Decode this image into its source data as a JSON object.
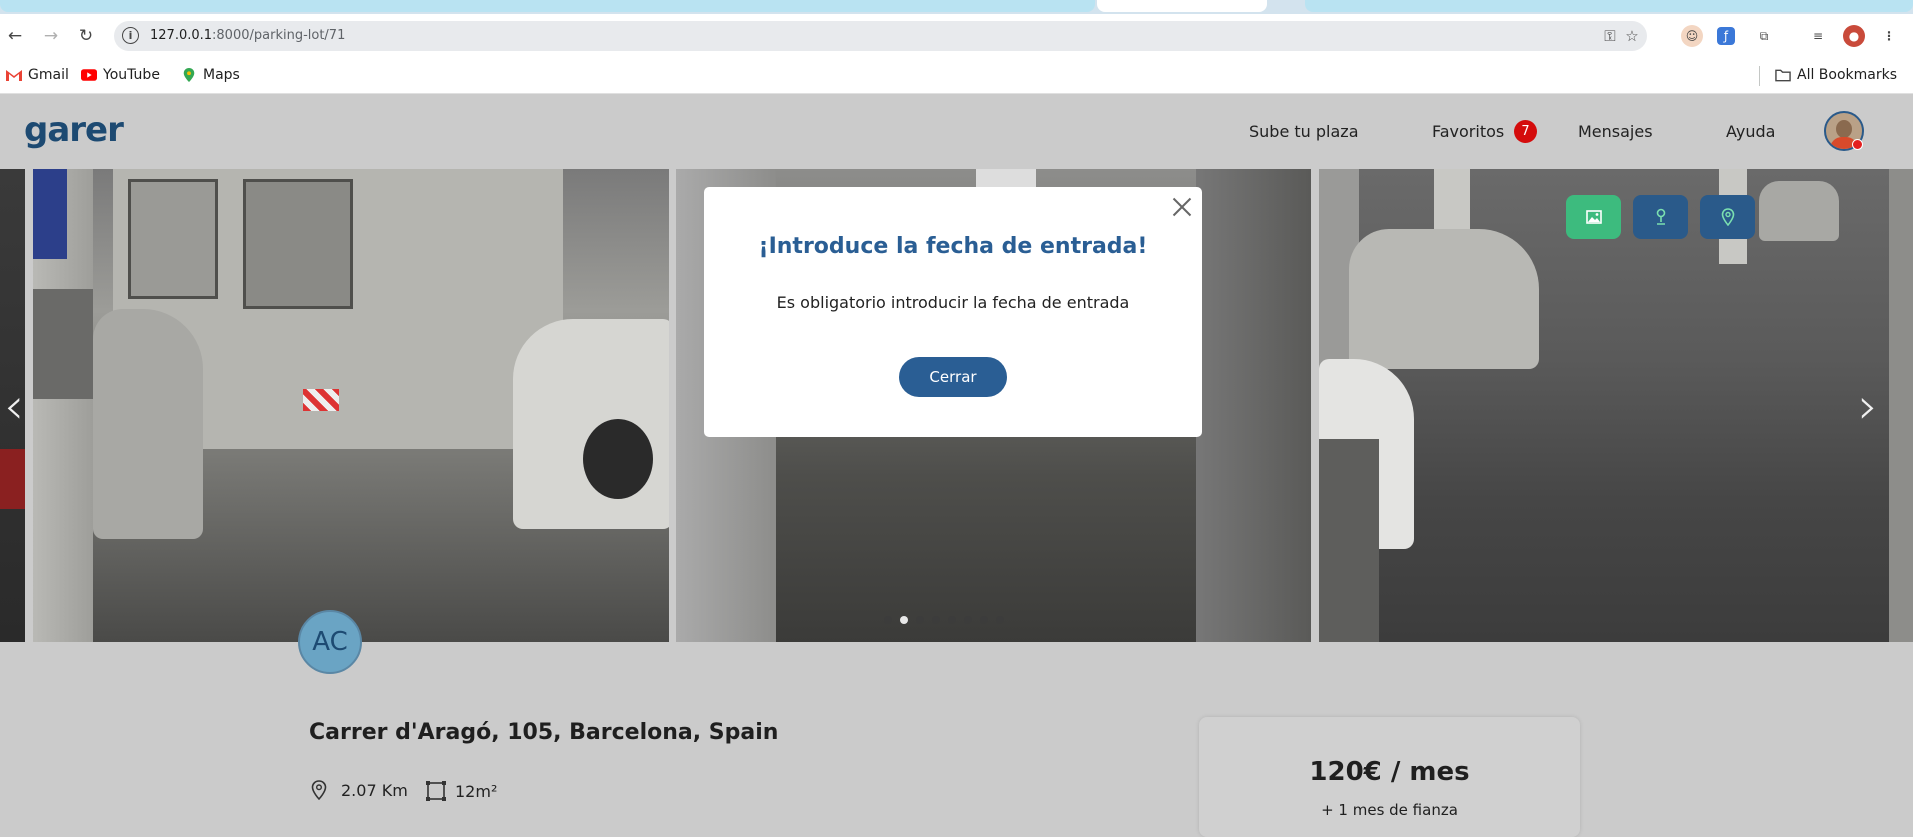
{
  "browser": {
    "url_host": "127.0.0.1",
    "url_rest": ":8000/parking-lot/71",
    "bookmarks": [
      "Gmail",
      "YouTube",
      "Maps"
    ],
    "all_bookmarks": "All Bookmarks"
  },
  "header": {
    "logo": "garer",
    "nav": {
      "upload": "Sube tu plaza",
      "favorites": "Favoritos",
      "favorites_count": "7",
      "messages": "Mensajes",
      "help": "Ayuda"
    }
  },
  "gallery": {
    "buttons": [
      "image-icon",
      "street-view-icon",
      "location-pin-icon"
    ],
    "button_colors": [
      "#3dbb7e",
      "#2a5a8a",
      "#2a5a8a"
    ],
    "dots_total": 8,
    "dots_active_index": 1
  },
  "listing": {
    "owner_initials": "AC",
    "address": "Carrer d'Aragó, 105, Barcelona, Spain",
    "distance": "2.07 Km",
    "size": "12m²",
    "price": "120€ / mes",
    "deposit": "+ 1 mes de fianza"
  },
  "modal": {
    "title": "¡Introduce la fecha de entrada!",
    "message": "Es obligatorio introducir la fecha de entrada",
    "close_button": "Cerrar"
  }
}
